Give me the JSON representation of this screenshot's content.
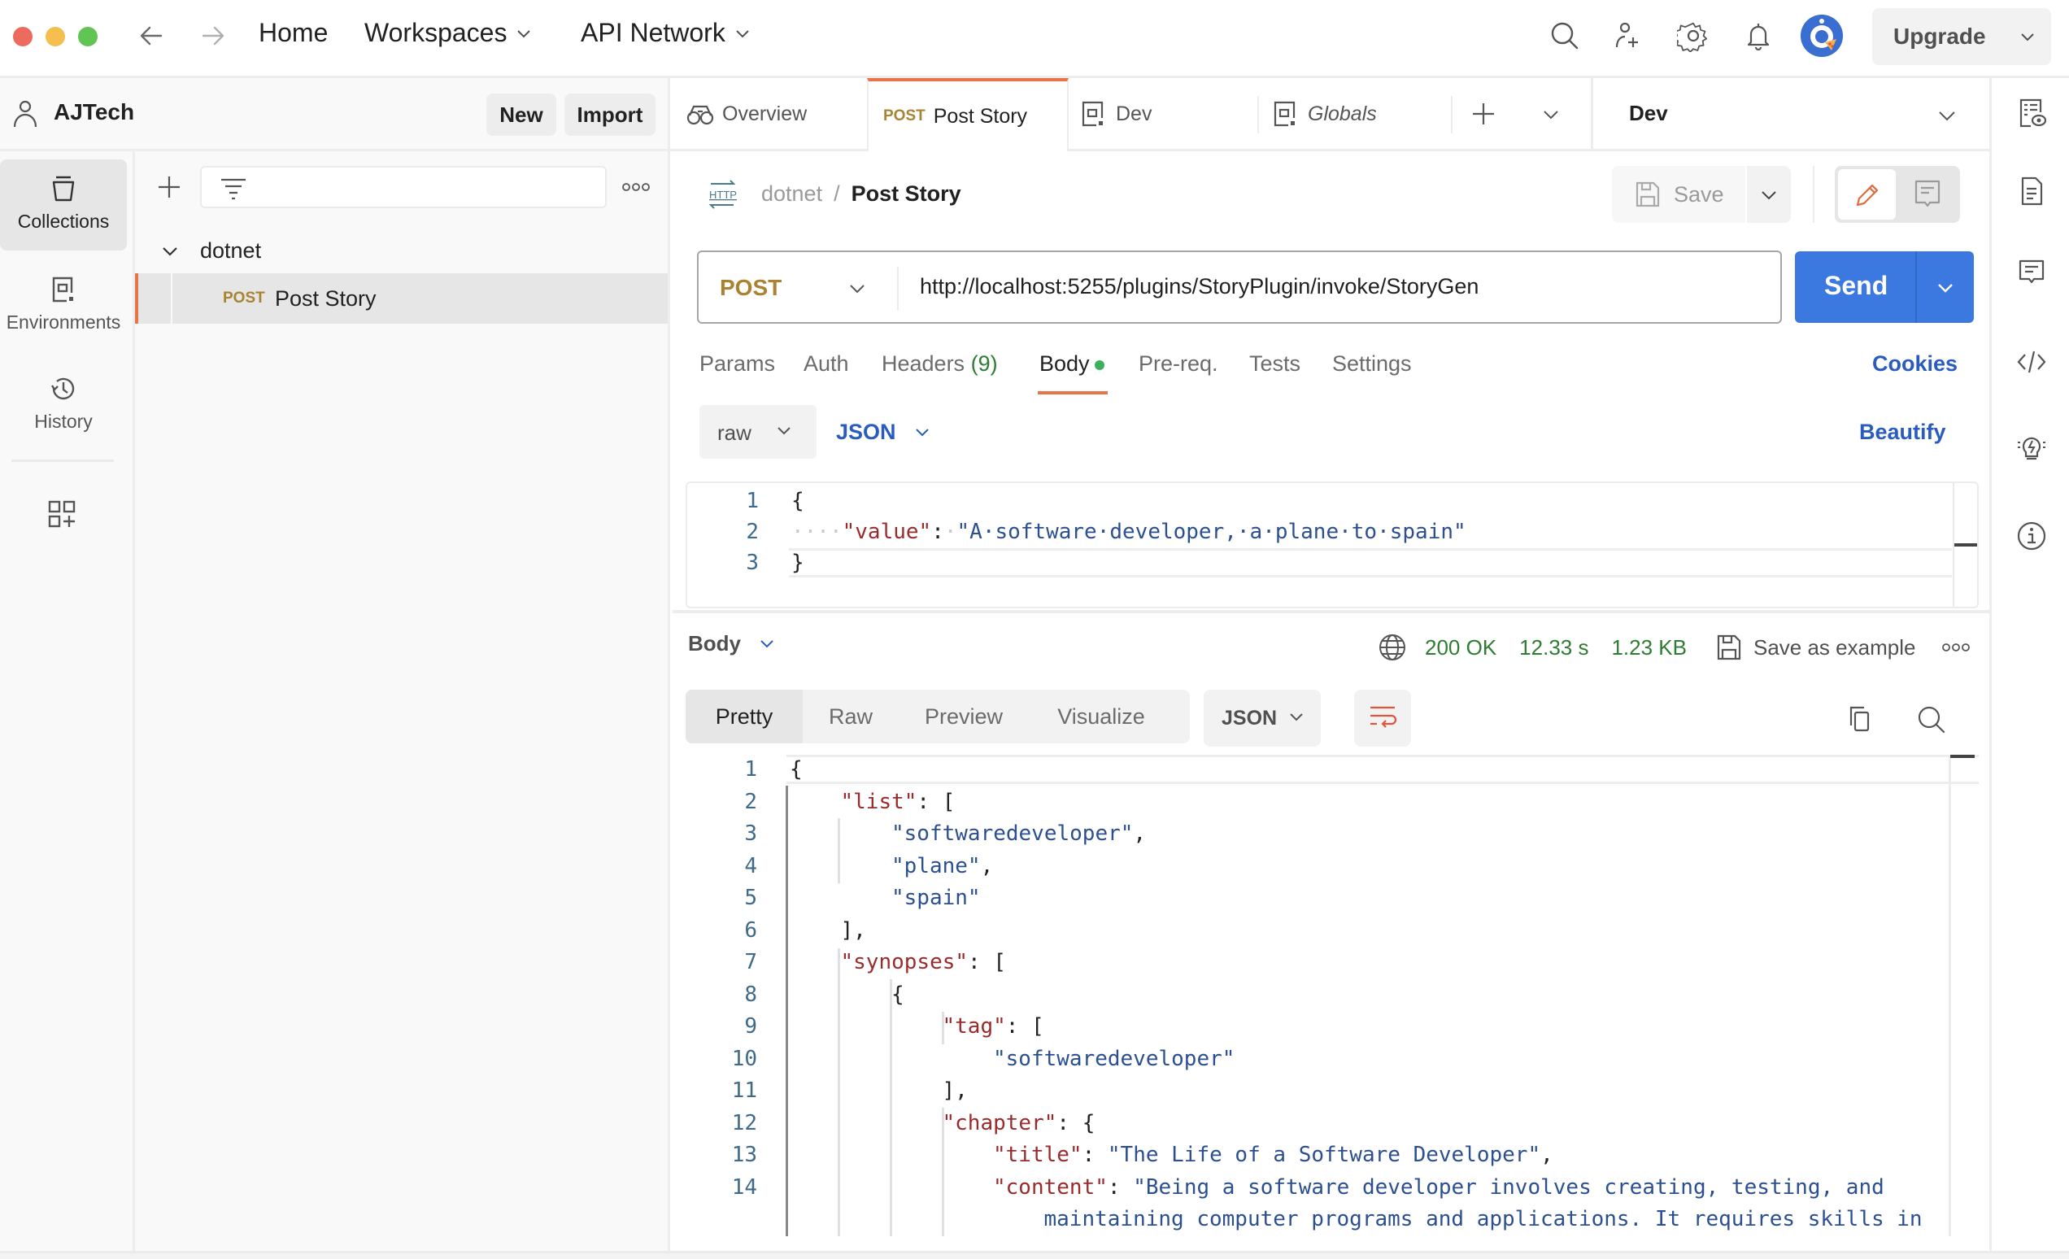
{
  "window": {
    "nav": {
      "home": "Home",
      "workspaces": "Workspaces",
      "api_network": "API Network"
    },
    "upgrade_label": "Upgrade",
    "icons": [
      "back-arrow-icon",
      "forward-arrow-icon",
      "search-icon",
      "invite-user-icon",
      "settings-gear-icon",
      "notification-bell-icon",
      "avatar"
    ]
  },
  "workspace": {
    "name": "AJTech",
    "new_label": "New",
    "import_label": "Import"
  },
  "rail": {
    "items": [
      {
        "label": "Collections",
        "icon": "collections-icon",
        "active": true
      },
      {
        "label": "Environments",
        "icon": "environments-icon",
        "active": false
      },
      {
        "label": "History",
        "icon": "history-icon",
        "active": false
      }
    ],
    "extra_icon": "add-workbench-icon"
  },
  "collections": {
    "filter_placeholder": "",
    "folder": "dotnet",
    "request": {
      "method": "POST",
      "name": "Post Story"
    }
  },
  "tabs": [
    {
      "label": "Overview",
      "icon": "overview-icon",
      "method": ""
    },
    {
      "label": "Post Story",
      "icon": "",
      "method": "POST",
      "active": true
    },
    {
      "label": "Dev",
      "icon": "environment-icon",
      "method": ""
    },
    {
      "label": "Globals",
      "icon": "environment-icon",
      "method": "",
      "italic": true
    }
  ],
  "environment": {
    "selected": "Dev"
  },
  "request": {
    "breadcrumb": {
      "collection": "dotnet",
      "separator": "/",
      "name": "Post Story"
    },
    "save_label": "Save",
    "method": "POST",
    "url": "http://localhost:5255/plugins/StoryPlugin/invoke/StoryGen",
    "send_label": "Send",
    "tabs": [
      {
        "label": "Params"
      },
      {
        "label": "Auth"
      },
      {
        "label": "Headers",
        "count": "(9)"
      },
      {
        "label": "Body",
        "active": true,
        "indicator": true
      },
      {
        "label": "Pre-req."
      },
      {
        "label": "Tests"
      },
      {
        "label": "Settings"
      }
    ],
    "cookies_label": "Cookies",
    "body_type": "raw",
    "body_language": "JSON",
    "beautify_label": "Beautify",
    "body_lines": [
      {
        "n": "1",
        "tokens": [
          [
            "pun",
            "{"
          ]
        ]
      },
      {
        "n": "2",
        "tokens": [
          [
            "ws",
            "····"
          ],
          [
            "key",
            "\"value\""
          ],
          [
            "pun",
            ":"
          ],
          [
            "ws",
            "·"
          ],
          [
            "str",
            "\"A·software·developer,·a·plane·to·spain\""
          ]
        ]
      },
      {
        "n": "3",
        "tokens": [
          [
            "pun",
            "}"
          ]
        ]
      }
    ]
  },
  "response": {
    "section_label": "Body",
    "status": "200 OK",
    "time": "12.33 s",
    "size": "1.23 KB",
    "save_example_label": "Save as example",
    "view_tabs": [
      {
        "label": "Pretty",
        "active": true
      },
      {
        "label": "Raw"
      },
      {
        "label": "Preview"
      },
      {
        "label": "Visualize"
      }
    ],
    "language": "JSON",
    "lines": [
      {
        "n": "1",
        "indent": 0,
        "tokens": [
          [
            "pun",
            "{"
          ]
        ]
      },
      {
        "n": "2",
        "indent": 1,
        "tokens": [
          [
            "key",
            "\"list\""
          ],
          [
            "pun",
            ": ["
          ]
        ]
      },
      {
        "n": "3",
        "indent": 2,
        "tokens": [
          [
            "str",
            "\"softwaredeveloper\""
          ],
          [
            "pun",
            ","
          ]
        ]
      },
      {
        "n": "4",
        "indent": 2,
        "tokens": [
          [
            "str",
            "\"plane\""
          ],
          [
            "pun",
            ","
          ]
        ]
      },
      {
        "n": "5",
        "indent": 2,
        "tokens": [
          [
            "str",
            "\"spain\""
          ]
        ]
      },
      {
        "n": "6",
        "indent": 1,
        "tokens": [
          [
            "pun",
            "],"
          ]
        ]
      },
      {
        "n": "7",
        "indent": 1,
        "tokens": [
          [
            "key",
            "\"synopses\""
          ],
          [
            "pun",
            ": ["
          ]
        ]
      },
      {
        "n": "8",
        "indent": 2,
        "tokens": [
          [
            "pun",
            "{"
          ]
        ]
      },
      {
        "n": "9",
        "indent": 3,
        "tokens": [
          [
            "key",
            "\"tag\""
          ],
          [
            "pun",
            ": ["
          ]
        ]
      },
      {
        "n": "10",
        "indent": 4,
        "tokens": [
          [
            "str",
            "\"softwaredeveloper\""
          ]
        ]
      },
      {
        "n": "11",
        "indent": 3,
        "tokens": [
          [
            "pun",
            "],"
          ]
        ]
      },
      {
        "n": "12",
        "indent": 3,
        "tokens": [
          [
            "key",
            "\"chapter\""
          ],
          [
            "pun",
            ": {"
          ]
        ]
      },
      {
        "n": "13",
        "indent": 4,
        "tokens": [
          [
            "key",
            "\"title\""
          ],
          [
            "pun",
            ": "
          ],
          [
            "str",
            "\"The Life of a Software Developer\""
          ],
          [
            "pun",
            ","
          ]
        ]
      },
      {
        "n": "14",
        "indent": 4,
        "tokens": [
          [
            "key",
            "\"content\""
          ],
          [
            "pun",
            ": "
          ],
          [
            "str",
            "\"Being a software developer involves creating, testing, and"
          ]
        ]
      },
      {
        "n": "",
        "indent": 5,
        "tokens": [
          [
            "str",
            "maintaining computer programs and applications. It requires skills in"
          ]
        ]
      }
    ]
  },
  "right_rail": {
    "icons": [
      "environment-quick-look-icon",
      "documentation-icon",
      "comments-icon",
      "code-snippet-icon",
      "related-collections-icon",
      "info-icon"
    ]
  }
}
